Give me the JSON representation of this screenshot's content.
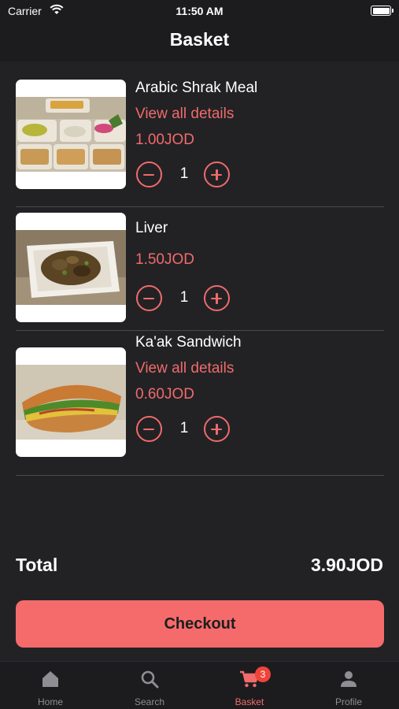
{
  "status_bar": {
    "carrier": "Carrier",
    "time": "11:50 AM"
  },
  "header": {
    "title": "Basket"
  },
  "items": [
    {
      "name": "Arabic Shrak Meal",
      "details_link": "View all details",
      "price": "1.00JOD",
      "quantity": "1"
    },
    {
      "name": "Liver",
      "price": "1.50JOD",
      "quantity": "1"
    },
    {
      "name": "Ka'ak Sandwich",
      "details_link": "View all details",
      "price": "0.60JOD",
      "quantity": "1"
    }
  ],
  "total": {
    "label": "Total",
    "value": "3.90JOD"
  },
  "checkout": {
    "label": "Checkout"
  },
  "tabs": [
    {
      "label": "Home",
      "icon": "home-icon"
    },
    {
      "label": "Search",
      "icon": "search-icon"
    },
    {
      "label": "Basket",
      "icon": "cart-icon",
      "badge": "3",
      "active": true
    },
    {
      "label": "Profile",
      "icon": "person-icon"
    }
  ],
  "colors": {
    "background": "#222225",
    "accent": "#f06b6b",
    "checkout_button": "#f56b6b",
    "badge": "#f0443a",
    "inactive_tab": "#8e8e93"
  }
}
